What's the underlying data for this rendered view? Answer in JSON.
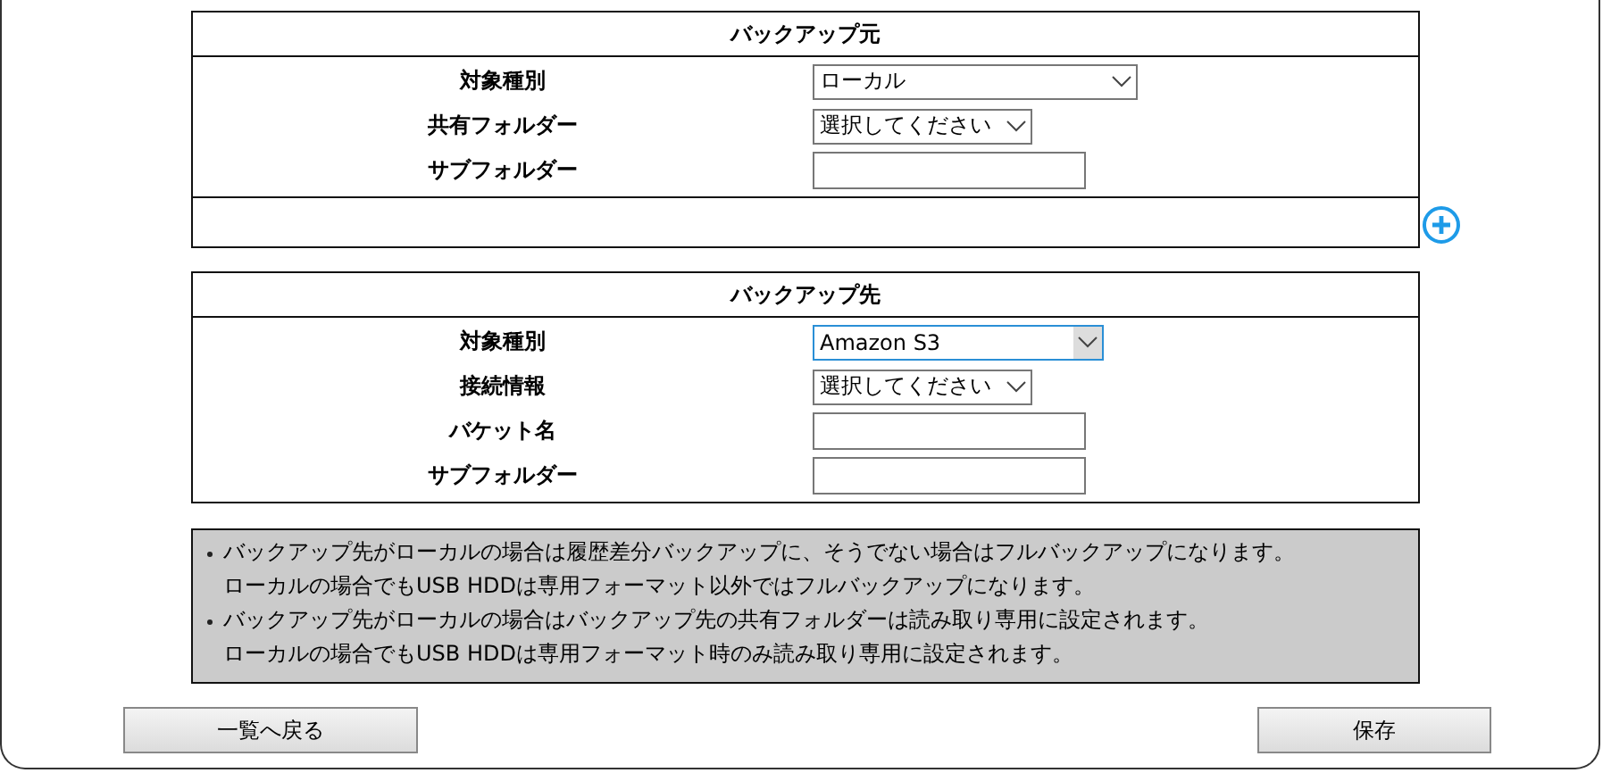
{
  "source": {
    "title": "バックアップ元",
    "fields": [
      {
        "label": "対象種別",
        "kind": "select",
        "value": "ローカル",
        "focused": false
      },
      {
        "label": "共有フォルダー",
        "kind": "select",
        "value": "選択してください",
        "focused": false
      },
      {
        "label": "サブフォルダー",
        "kind": "text"
      }
    ],
    "add_button": true
  },
  "destination": {
    "title": "バックアップ先",
    "fields": [
      {
        "label": "対象種別",
        "kind": "select",
        "value": "Amazon S3",
        "focused": true
      },
      {
        "label": "接続情報",
        "kind": "select",
        "value": "選択してください",
        "focused": false
      },
      {
        "label": "バケット名",
        "kind": "text"
      },
      {
        "label": "サブフォルダー",
        "kind": "text"
      }
    ]
  },
  "notes": [
    {
      "lines": [
        "バックアップ先がローカルの場合は履歴差分バックアップに、そうでない場合はフルバックアップになります。",
        "ローカルの場合でもUSB HDDは専用フォーマット以外ではフルバックアップになります。"
      ]
    },
    {
      "lines": [
        "バックアップ先がローカルの場合はバックアップ先の共有フォルダーは読み取り専用に設定されます。",
        "ローカルの場合でもUSB HDDは専用フォーマット時のみ読み取り専用に設定されます。"
      ]
    }
  ],
  "buttons": {
    "back": "一覧へ戻る",
    "save": "保存"
  }
}
